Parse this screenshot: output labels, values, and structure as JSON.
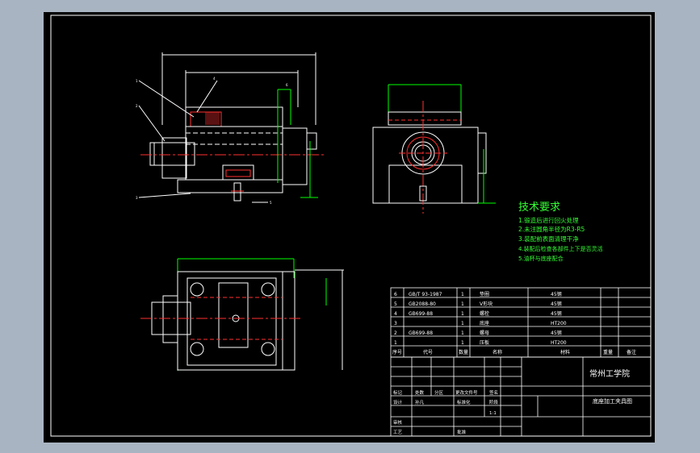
{
  "colors": {
    "background_app": "#a9b4c2",
    "canvas": "#000000",
    "line_white": "#ffffff",
    "line_green": "#00ff00",
    "line_red": "#ff3030",
    "text_green": "#33ff33"
  },
  "tech_requirements": {
    "title": "技术要求",
    "items": [
      "1.锻造后进行回火处理",
      "2.未注圆角半径为R3-R5",
      "3.装配前表面清理干净",
      "4.装配后检查各部件上下是否灵活",
      "5.油杯与底座配合"
    ]
  },
  "parts_table": {
    "rows": [
      {
        "no": "6",
        "code": "GB/T 93-1987",
        "qty": "1",
        "name": "垫圈",
        "material": "45钢"
      },
      {
        "no": "5",
        "code": "GB2088-80",
        "qty": "1",
        "name": "V形块",
        "material": "45钢"
      },
      {
        "no": "4",
        "code": "GB699-88",
        "qty": "1",
        "name": "螺栓",
        "material": "45钢"
      },
      {
        "no": "3",
        "code": "",
        "qty": "1",
        "name": "底座",
        "material": "HT200"
      },
      {
        "no": "2",
        "code": "GB699-88",
        "qty": "1",
        "name": "螺母",
        "material": "45钢"
      },
      {
        "no": "1",
        "code": "",
        "qty": "1",
        "name": "压板",
        "material": "HT200"
      }
    ],
    "header": {
      "no": "序号",
      "code": "代号",
      "qty": "数量",
      "name": "名称",
      "material": "材料",
      "weight": "重量",
      "remark": "备注"
    }
  },
  "title_block": {
    "school": "常州工学院",
    "drawing_name": "底座加工夹具图",
    "labels": {
      "mark": "标记",
      "count": "处数",
      "zone": "分区",
      "change_doc": "更改文件号",
      "sign": "签名",
      "design": "设计",
      "standardize": "标准化",
      "stage": "阶段",
      "review": "审核",
      "process": "工艺",
      "approve": "批准"
    },
    "design_value": "孙凡",
    "scale_value": "1:1"
  },
  "callouts": [
    "1",
    "2",
    "3",
    "4",
    "5",
    "6"
  ]
}
